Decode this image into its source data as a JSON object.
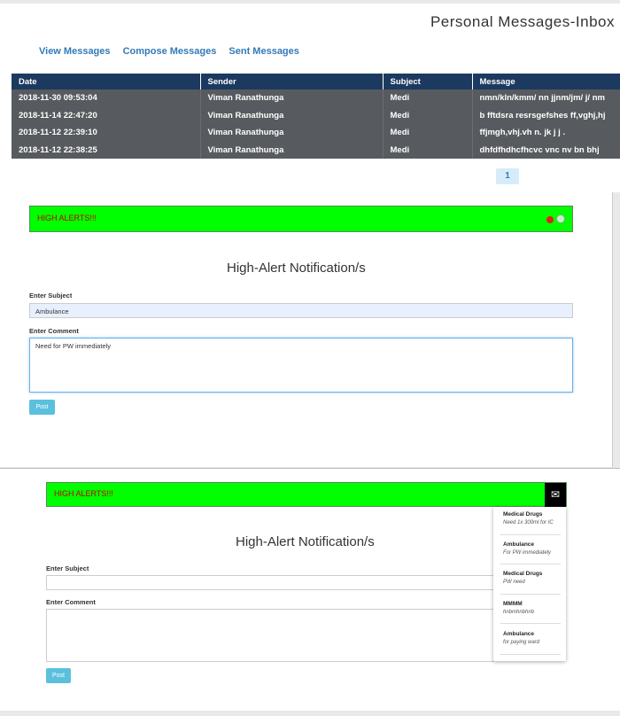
{
  "inbox": {
    "title": "Personal Messages-Inbox",
    "nav": [
      "View Messages",
      "Compose Messages",
      "Sent Messages"
    ],
    "columns": [
      "Date",
      "Sender",
      "Subject",
      "Message"
    ],
    "rows": [
      [
        "2018-11-30 09:53:04",
        "Viman Ranathunga",
        "Medi",
        "nmn/kln/kmm/ nn jjnm/jm/ j/ nm"
      ],
      [
        "2018-11-14 22:47:20",
        "Viman Ranathunga",
        "Medi",
        "b fftdsra resrsgefshes ff,vghj,hj"
      ],
      [
        "2018-11-12 22:39:10",
        "Viman Ranathunga",
        "Medi",
        "ffjmgh,vhj.vh n. jk j j ."
      ],
      [
        "2018-11-12 22:38:25",
        "Viman Ranathunga",
        "Medi",
        "dhfdfhdhcfhcvc vnc nv bn bhj"
      ]
    ],
    "page": "1",
    "colors": {
      "header": "#1c3a60",
      "row": "#575a5e",
      "link": "#337ab7"
    }
  },
  "alert1": {
    "banner": "HIGH ALERTS!!!",
    "badge_count": "3",
    "heading": "High-Alert Notification/s",
    "subject_label": "Enter Subject",
    "subject_value": "Ambulance",
    "comment_label": "Enter Comment",
    "comment_value": "Need for PW immediately",
    "post_label": "Post",
    "colors": {
      "banner": "#00ff00",
      "banner_text": "#c00000",
      "button": "#5bc0de"
    }
  },
  "alert2": {
    "banner": "HIGH ALERTS!!!",
    "envelope_icon": "envelope-icon",
    "heading": "High-Alert Notification/s",
    "subject_label": "Enter Subject",
    "subject_value": "",
    "comment_label": "Enter Comment",
    "comment_value": "",
    "post_label": "Post",
    "notifications": [
      {
        "subject": "Medical Drugs",
        "comment": "Need 1x 300ml for IC"
      },
      {
        "subject": "Ambulance",
        "comment": "For PW immediately"
      },
      {
        "subject": "Medical Drugs",
        "comment": "PW need"
      },
      {
        "subject": "MMMM",
        "comment": "hnbmhnbhnb"
      },
      {
        "subject": "Ambulance",
        "comment": "for paying ward"
      }
    ]
  }
}
